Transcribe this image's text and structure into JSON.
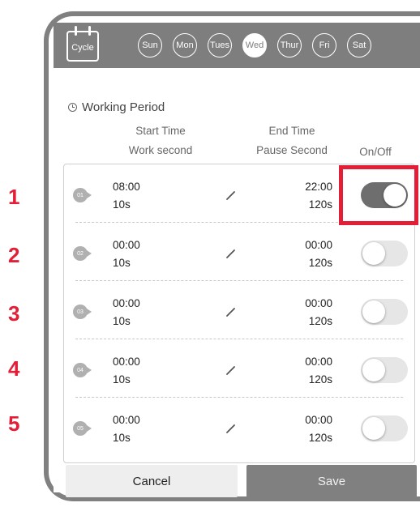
{
  "header": {
    "cycle_label": "Cycle",
    "days": [
      {
        "label": "Sun",
        "active": false
      },
      {
        "label": "Mon",
        "active": false
      },
      {
        "label": "Tues",
        "active": false
      },
      {
        "label": "Wed",
        "active": true
      },
      {
        "label": "Thur",
        "active": false
      },
      {
        "label": "Fri",
        "active": false
      },
      {
        "label": "Sat",
        "active": false
      }
    ]
  },
  "section": {
    "title": "Working Period",
    "col_start": "Start Time",
    "col_work": "Work second",
    "col_end": "End Time",
    "col_pause": "Pause Second",
    "col_onoff": "On/Off"
  },
  "periods": [
    {
      "badge": "01",
      "start": "08:00",
      "work": "10s",
      "end": "22:00",
      "pause": "120s",
      "on": true
    },
    {
      "badge": "02",
      "start": "00:00",
      "work": "10s",
      "end": "00:00",
      "pause": "120s",
      "on": false
    },
    {
      "badge": "03",
      "start": "00:00",
      "work": "10s",
      "end": "00:00",
      "pause": "120s",
      "on": false
    },
    {
      "badge": "04",
      "start": "00:00",
      "work": "10s",
      "end": "00:00",
      "pause": "120s",
      "on": false
    },
    {
      "badge": "05",
      "start": "00:00",
      "work": "10s",
      "end": "00:00",
      "pause": "120s",
      "on": false
    }
  ],
  "annotations": [
    "1",
    "2",
    "3",
    "4",
    "5"
  ],
  "buttons": {
    "cancel": "Cancel",
    "save": "Save"
  },
  "colors": {
    "header": "#7e7e7e",
    "toggle_on": "#6e6e6e",
    "highlight": "#e21f36"
  }
}
